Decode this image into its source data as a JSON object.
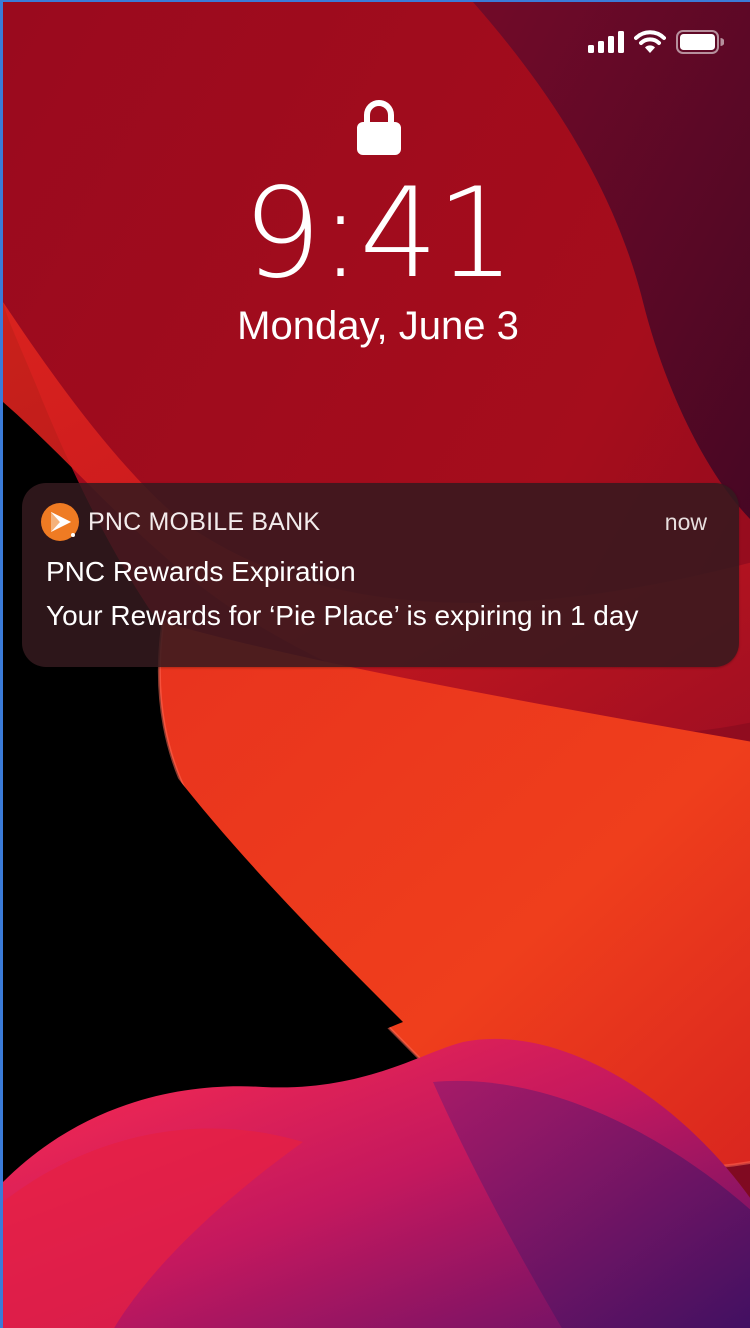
{
  "status_bar": {
    "icons": [
      "signal-icon",
      "wifi-icon",
      "battery-icon"
    ]
  },
  "lock_screen": {
    "lock_icon": "lock-icon",
    "time": "9:41",
    "date": "Monday, June 3"
  },
  "notification": {
    "app_icon": "pnc-logo-icon",
    "app_name": "PNC MOBILE BANK",
    "timestamp": "now",
    "title": "PNC Rewards Expiration",
    "body": "Your Rewards for ‘Pie Place’ is expiring in 1 day"
  },
  "colors": {
    "wallpaper_red": "#c0161c",
    "wallpaper_orange": "#ee3a1c",
    "wallpaper_magenta": "#a01a5a",
    "pnc_orange": "#ef7b23"
  }
}
